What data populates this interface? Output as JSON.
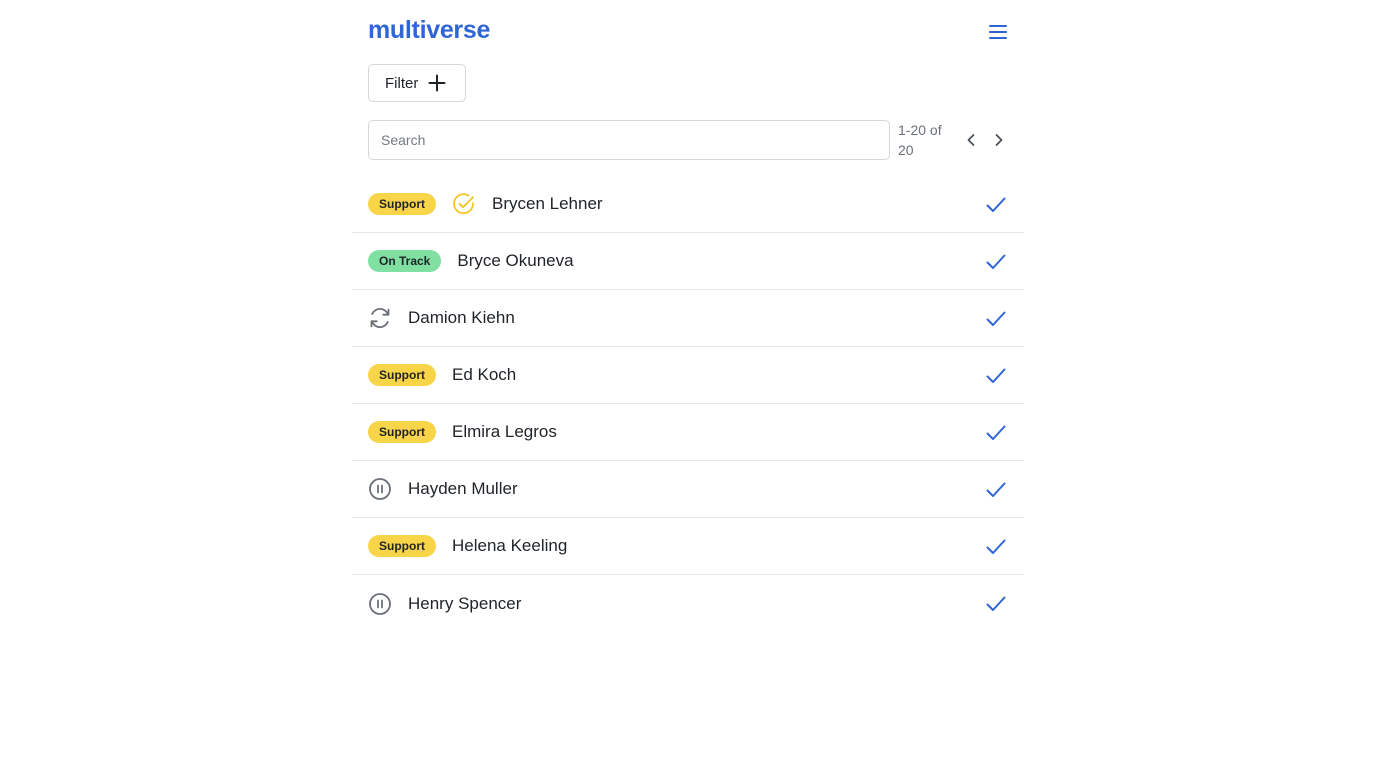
{
  "header": {
    "brand": "multiverse",
    "menu_icon": "hamburger-menu-icon"
  },
  "toolbar": {
    "filter_label": "Filter",
    "filter_icon": "plus-icon"
  },
  "search": {
    "placeholder": "Search",
    "value": ""
  },
  "pagination": {
    "range_text": "1-20 of 20",
    "prev_icon": "chevron-left-icon",
    "next_icon": "chevron-right-icon"
  },
  "colors": {
    "accent": "#2f66d6",
    "support_badge": "#f8d548",
    "ontrack_badge": "#7fe0a2",
    "status_gray": "#6b7078",
    "status_yellow": "#f3c623"
  },
  "rows": [
    {
      "badge": "Support",
      "status_icon": "check-circle-icon",
      "name": "Brycen Lehner",
      "checked": true
    },
    {
      "badge": "On Track",
      "status_icon": "",
      "name": "Bryce Okuneva",
      "checked": true
    },
    {
      "badge": "",
      "status_icon": "refresh-icon",
      "name": "Damion Kiehn",
      "checked": true
    },
    {
      "badge": "Support",
      "status_icon": "",
      "name": "Ed Koch",
      "checked": true
    },
    {
      "badge": "Support",
      "status_icon": "",
      "name": "Elmira Legros",
      "checked": true
    },
    {
      "badge": "",
      "status_icon": "pause-circle-icon",
      "name": "Hayden Muller",
      "checked": true
    },
    {
      "badge": "Support",
      "status_icon": "",
      "name": "Helena Keeling",
      "checked": true
    },
    {
      "badge": "",
      "status_icon": "pause-circle-icon",
      "name": "Henry Spencer",
      "checked": true
    }
  ]
}
